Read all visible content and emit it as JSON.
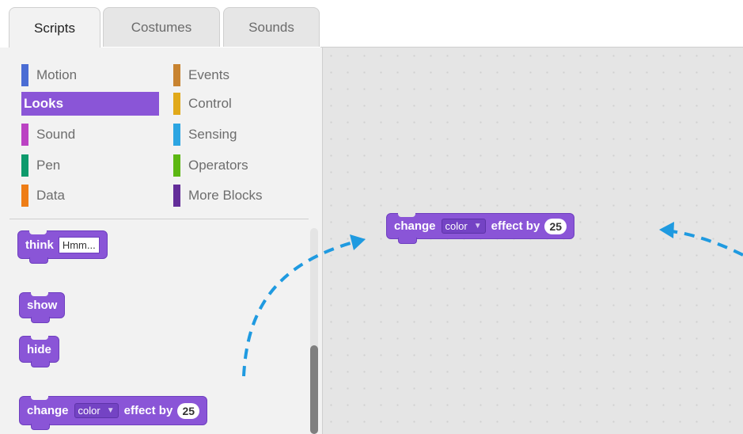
{
  "tabs": [
    {
      "label": "Scripts",
      "active": true
    },
    {
      "label": "Costumes",
      "active": false
    },
    {
      "label": "Sounds",
      "active": false
    }
  ],
  "categories": [
    {
      "label": "Motion",
      "color": "#4a6cd4"
    },
    {
      "label": "Looks",
      "color": "#8a55d7",
      "active": true
    },
    {
      "label": "Sound",
      "color": "#bb42c3"
    },
    {
      "label": "Pen",
      "color": "#0e9a6c"
    },
    {
      "label": "Data",
      "color": "#ee7d16"
    },
    {
      "label": "Events",
      "color": "#c88330"
    },
    {
      "label": "Control",
      "color": "#e1a91a"
    },
    {
      "label": "Sensing",
      "color": "#2ca5e2"
    },
    {
      "label": "Operators",
      "color": "#5cb712"
    },
    {
      "label": "More Blocks",
      "color": "#632d99"
    }
  ],
  "palette_blocks": {
    "think": {
      "label": "think",
      "input": "Hmm..."
    },
    "show": {
      "label": "show"
    },
    "hide": {
      "label": "hide"
    },
    "change_effect": {
      "label": "change",
      "dropdown": "color",
      "label2": "effect by",
      "value": "25"
    }
  },
  "script_block": {
    "label": "change",
    "dropdown": "color",
    "label2": "effect by",
    "value": "25"
  },
  "colors": {
    "looks_block": "#8a55d7",
    "arrow": "#1f9ae0"
  }
}
